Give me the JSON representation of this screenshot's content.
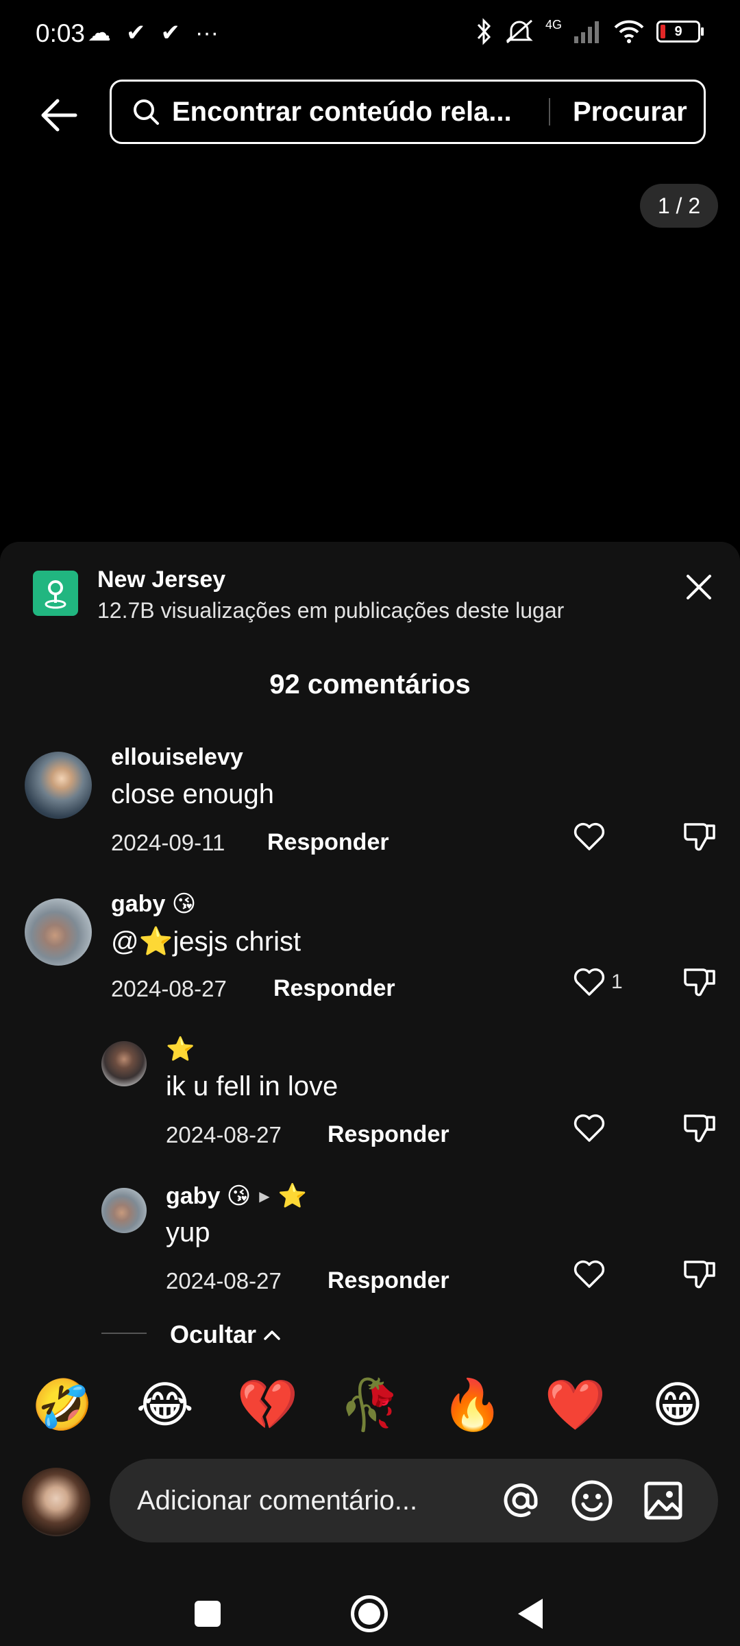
{
  "status_bar": {
    "time": "0:03",
    "left_icons": [
      "cloud-icon",
      "check-icon",
      "check-icon",
      "more-dots-icon"
    ],
    "right_icons": [
      "bluetooth-icon",
      "mute-icon",
      "signal-4g-icon",
      "wifi-icon"
    ],
    "network_label": "4G",
    "battery_level": "9"
  },
  "search": {
    "placeholder": "Encontrar conteúdo rela...",
    "button_label": "Procurar"
  },
  "page_indicator": "1 / 2",
  "location": {
    "name": "New Jersey",
    "views": "12.7B visualizações em publicações deste lugar"
  },
  "comments_header": "92 comentários",
  "comments": [
    {
      "username": "ellouiselevy",
      "text": "close enough",
      "date": "2024-09-11",
      "reply_label": "Responder",
      "likes": ""
    },
    {
      "username": "gaby 😘",
      "text": "@⭐jesjs christ",
      "date": "2024-08-27",
      "reply_label": "Responder",
      "likes": "1"
    }
  ],
  "replies": [
    {
      "username": "⭐",
      "text": "ik u fell in love",
      "date": "2024-08-27",
      "reply_label": "Responder"
    },
    {
      "username": "gaby 😘",
      "reply_to": "⭐",
      "text": "yup",
      "date": "2024-08-27",
      "reply_label": "Responder"
    }
  ],
  "hide_label": "Ocultar",
  "emojis": [
    "🤣",
    "😂",
    "💔",
    "🥀",
    "🔥",
    "❤️",
    "😁"
  ],
  "composer": {
    "placeholder": "Adicionar comentário..."
  },
  "colors": {
    "background": "#000000",
    "sheet": "#121212",
    "location_badge": "#21b680",
    "input_bg": "#2a2a2a"
  }
}
